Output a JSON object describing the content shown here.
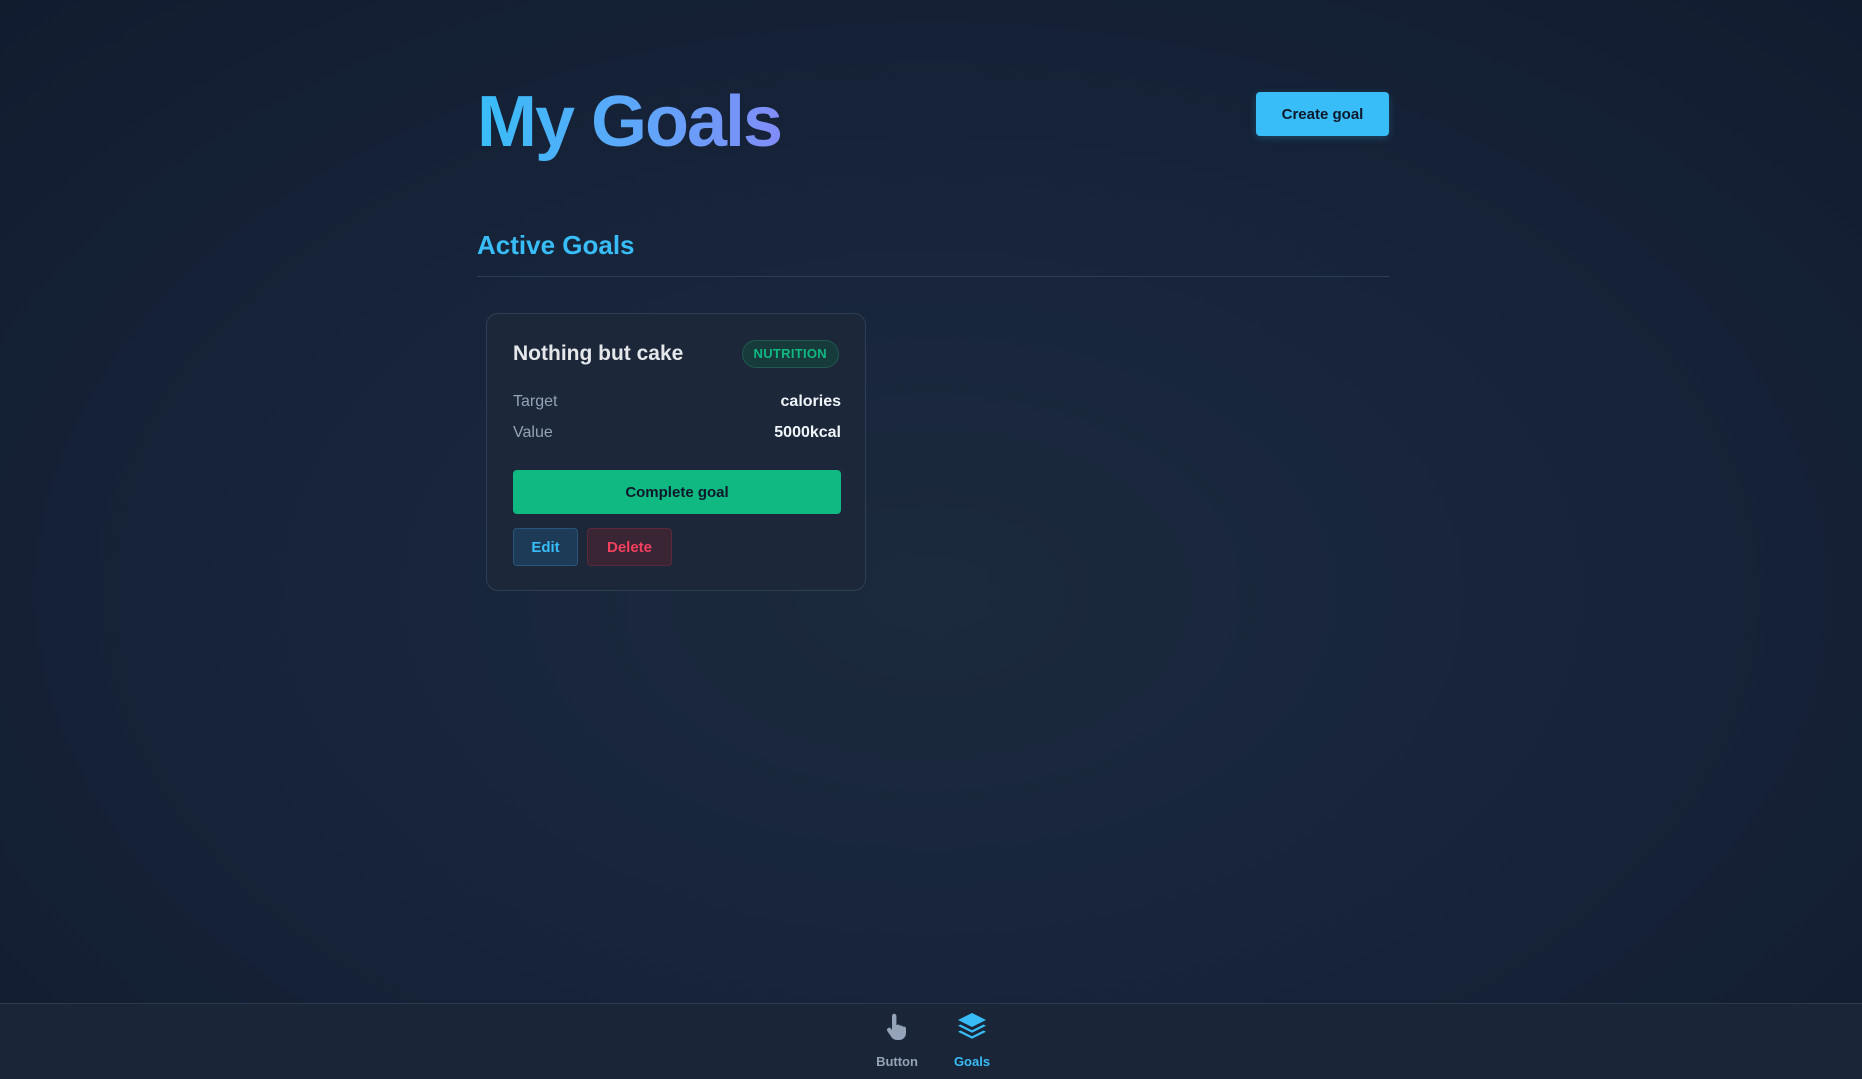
{
  "header": {
    "title": "My Goals",
    "create_label": "Create goal"
  },
  "section": {
    "title": "Active Goals"
  },
  "goals": [
    {
      "title": "Nothing but cake",
      "category": "NUTRITION",
      "target_label": "Target",
      "target_value": "calories",
      "value_label": "Value",
      "value_value": "5000kcal",
      "complete_label": "Complete goal",
      "edit_label": "Edit",
      "delete_label": "Delete"
    }
  ],
  "nav": {
    "items": [
      {
        "label": "Button",
        "icon": "pointer-hand-icon",
        "active": false
      },
      {
        "label": "Goals",
        "icon": "layers-icon",
        "active": true
      }
    ]
  },
  "colors": {
    "accent": "#38bdf8",
    "success": "#10b981",
    "danger": "#f43f5e",
    "background": "#17243a"
  }
}
